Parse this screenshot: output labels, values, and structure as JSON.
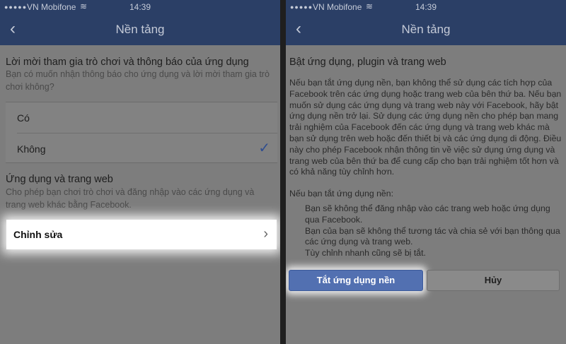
{
  "left": {
    "status": {
      "signal": "●●●●●",
      "carrier": "VN Mobifone",
      "wifi": "≋",
      "time": "14:39"
    },
    "nav": {
      "back": "‹",
      "title": "Nền tảng"
    },
    "notify": {
      "title": "Lời mời tham gia trò chơi và thông báo của ứng dụng",
      "desc": "Bạn có muốn nhận thông báo cho ứng dụng và lời mời tham gia trò chơi không?",
      "options": [
        {
          "label": "Có",
          "selected": false
        },
        {
          "label": "Không",
          "selected": true
        }
      ],
      "check": "✓"
    },
    "apps": {
      "title": "Ứng dụng và trang web",
      "desc": "Cho phép bạn chơi trò chơi và đăng nhập vào các ứng dụng và trang web khác bằng Facebook.",
      "edit_label": "Chỉnh sửa",
      "chevron": "›"
    }
  },
  "right": {
    "status": {
      "signal": "●●●●●",
      "carrier": "VN Mobifone",
      "wifi": "≋",
      "time": "14:39"
    },
    "nav": {
      "back": "‹",
      "title": "Nền tảng"
    },
    "title": "Bật ứng dụng, plugin và trang web",
    "paragraph": "Nếu bạn tắt ứng dụng nền, bạn không thể sử dụng các tích hợp của Facebook trên các ứng dụng hoặc trang web của bên thứ ba. Nếu bạn muốn sử dụng các ứng dụng và trang web này với Facebook, hãy bật ứng dụng nền trở lại. Sử dụng các ứng dụng nền cho phép bạn mang trải nghiệm của Facebook đến các ứng dụng và trang web khác mà bạn sử dụng trên web hoặc đến thiết bị và các ứng dụng di động. Điều này cho phép Facebook nhận thông tin về việc sử dụng ứng dụng và trang web của bên thứ ba để cung cấp cho bạn trải nghiệm tốt hơn và có khả năng tùy chỉnh hơn.",
    "subheading": "Nếu bạn tắt ứng dụng nền:",
    "consequences": [
      "Bạn sẽ không thể đăng nhập vào các trang web hoặc ứng dụng qua Facebook.",
      "Bạn của bạn sẽ không thể tương tác và chia sẻ với bạn thông qua các ứng dụng và trang web.",
      "Tùy chỉnh nhanh cũng sẽ bị tắt."
    ],
    "primary_button": "Tắt ứng dụng nền",
    "cancel_button": "Hủy"
  }
}
